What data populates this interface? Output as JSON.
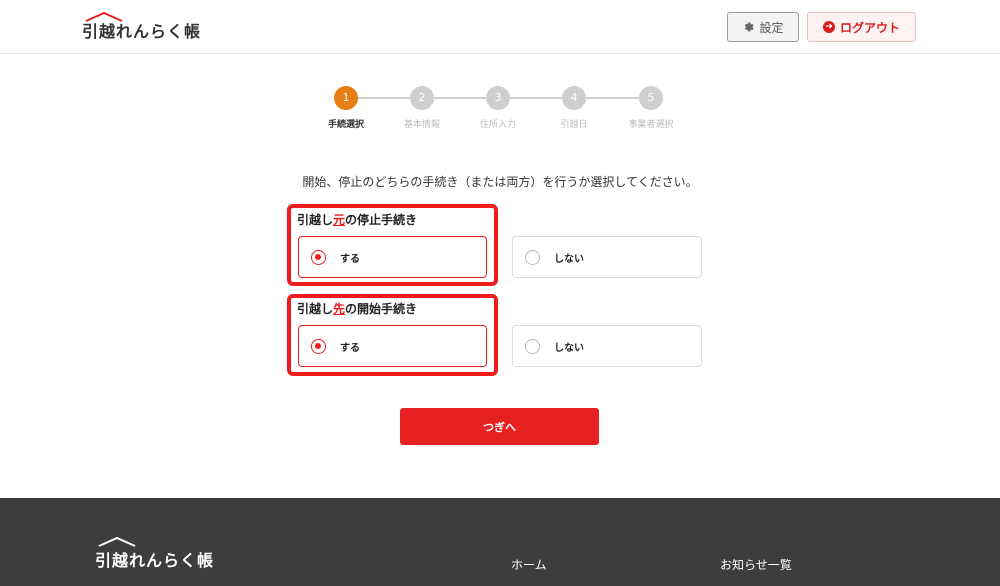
{
  "header": {
    "logo_text": "引越れんらく帳",
    "settings_label": "設定",
    "logout_label": "ログアウト"
  },
  "stepper": {
    "steps": [
      {
        "number": "1",
        "label": "手続選択",
        "active": true
      },
      {
        "number": "2",
        "label": "基本情報",
        "active": false
      },
      {
        "number": "3",
        "label": "住所入力",
        "active": false
      },
      {
        "number": "4",
        "label": "引越日",
        "active": false
      },
      {
        "number": "5",
        "label": "事業者選択",
        "active": false
      }
    ]
  },
  "main": {
    "instruction": "開始、停止のどちらの手続き（または両方）を行うか選択してください。",
    "questions": [
      {
        "title_prefix": "引越し",
        "title_highlight": "元",
        "title_suffix": "の停止手続き",
        "options": [
          {
            "label": "する",
            "selected": true
          },
          {
            "label": "しない",
            "selected": false
          }
        ]
      },
      {
        "title_prefix": "引越し",
        "title_highlight": "先",
        "title_suffix": "の開始手続き",
        "options": [
          {
            "label": "する",
            "selected": true
          },
          {
            "label": "しない",
            "selected": false
          }
        ]
      }
    ],
    "next_label": "つぎへ"
  },
  "footer": {
    "logo_text": "引越れんらく帳",
    "links": [
      "ホーム",
      "お知らせ一覧"
    ]
  },
  "colors": {
    "accent_red": "#ee1c1c",
    "step_active": "#e67e14",
    "footer_bg": "#3d3d3d"
  },
  "icons": {
    "settings": "gear-icon",
    "logout": "arrow-circle-right-icon",
    "logo": "house-roof-icon"
  }
}
